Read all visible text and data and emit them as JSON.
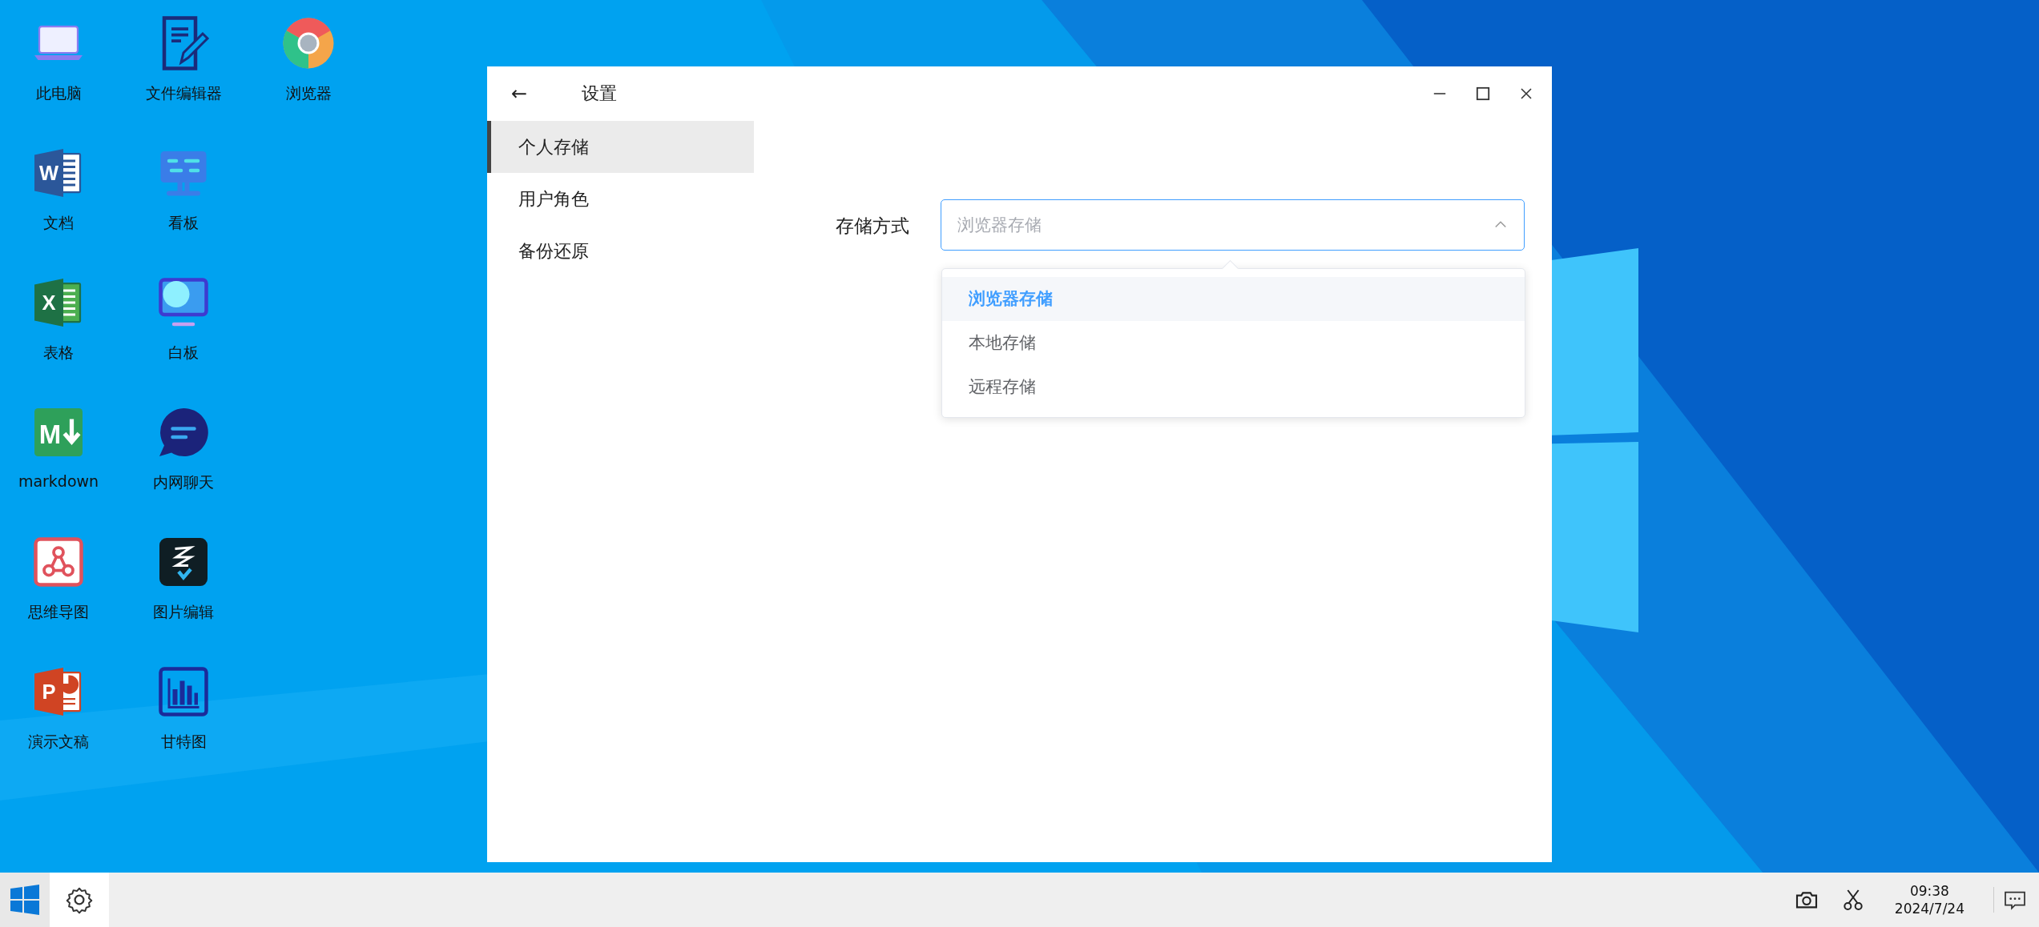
{
  "desktop_icons": [
    {
      "label": "此电脑",
      "kind": "laptop"
    },
    {
      "label": "文档",
      "kind": "word",
      "glyph": "W"
    },
    {
      "label": "表格",
      "kind": "sheet",
      "glyph": "X"
    },
    {
      "label": "markdown",
      "kind": "markdown",
      "glyph": "M"
    },
    {
      "label": "思维导图",
      "kind": "mindmap"
    },
    {
      "label": "演示文稿",
      "kind": "slides",
      "glyph": "P"
    },
    {
      "label": "文件编辑器",
      "kind": "editor"
    },
    {
      "label": "看板",
      "kind": "kanban"
    },
    {
      "label": "白板",
      "kind": "whiteboard"
    },
    {
      "label": "内网聊天",
      "kind": "chat"
    },
    {
      "label": "图片编辑",
      "kind": "imageedit"
    },
    {
      "label": "甘特图",
      "kind": "gantt"
    },
    {
      "label": "浏览器",
      "kind": "browser"
    }
  ],
  "window": {
    "back": "←",
    "title": "设置",
    "sidebar": {
      "items": [
        {
          "label": "个人存储",
          "selected": true
        },
        {
          "label": "用户角色",
          "selected": false
        },
        {
          "label": "备份还原",
          "selected": false
        }
      ]
    },
    "form": {
      "label": "存储方式",
      "select": {
        "placeholder": "浏览器存储",
        "expanded": true
      },
      "options": [
        {
          "label": "浏览器存储",
          "selected": true
        },
        {
          "label": "本地存储",
          "selected": false
        },
        {
          "label": "远程存储",
          "selected": false
        }
      ]
    }
  },
  "taskbar": {
    "apps": [
      {
        "kind": "settings",
        "active": true
      }
    ],
    "clock": {
      "time": "09:38",
      "date": "2024/7/24"
    }
  }
}
